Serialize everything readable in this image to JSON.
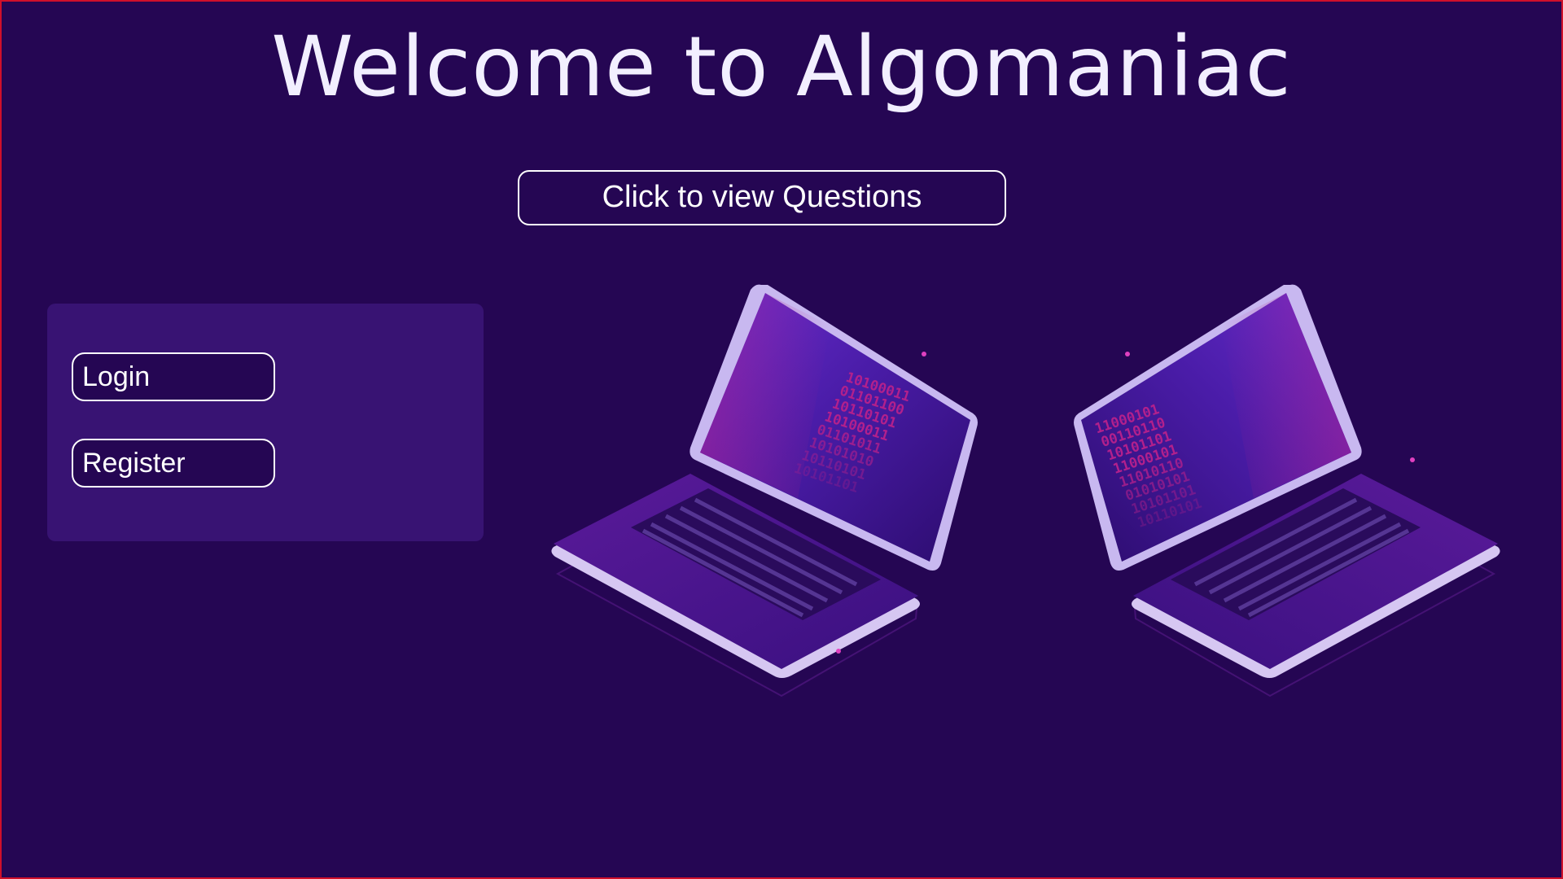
{
  "header": {
    "title": "Welcome to Algomaniac"
  },
  "main": {
    "questions_button_label": "Click to view Questions"
  },
  "auth": {
    "login_label": "Login",
    "register_label": "Register"
  },
  "illustration": {
    "left_screen_binary": [
      "10100011",
      "01101100",
      "10110101",
      "10100011",
      "01101011",
      "10101010",
      "10110101",
      "10101101"
    ],
    "right_screen_binary": [
      "11000101",
      "00110110",
      "10101101",
      "11000101",
      "11010110",
      "01010101",
      "10101101",
      "10110101"
    ]
  },
  "colors": {
    "background": "#250653",
    "panel": "#381373",
    "accent": "#d0102a",
    "screen_glow": "#b2208c"
  },
  "icons": {
    "laptop_left": "laptop-icon",
    "laptop_right": "laptop-icon"
  }
}
